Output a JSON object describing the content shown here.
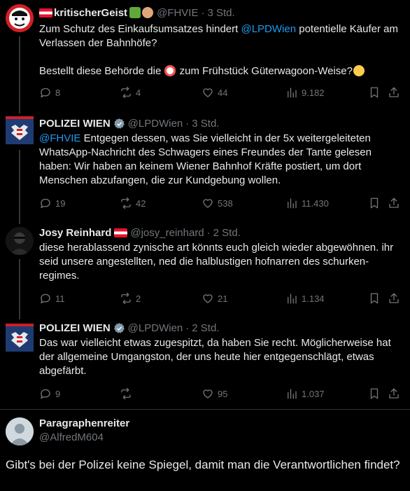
{
  "colors": {
    "background": "#000000",
    "text": "#e7e9ea",
    "muted": "#71767b",
    "link": "#1d9bf0",
    "verified": "#829aab"
  },
  "tweets": [
    {
      "name": "kritischerGeist",
      "handle": "@FHVIE",
      "time": "3 Std.",
      "text_before": "Zum Schutz des Einkaufsumsatzes hindert ",
      "mention": "@LPDWien",
      "text_after": " potentielle Käufer am Verlassen der Bahnhöfe?",
      "text2_before": "Bestellt diese Behörde die ",
      "text2_after": " zum Frühstück Güterwagoon-Weise?",
      "replies": "8",
      "reposts": "4",
      "likes": "44",
      "views": "9.182"
    },
    {
      "name": "POLIZEI WIEN",
      "handle": "@LPDWien",
      "time": "3 Std.",
      "mention": "@FHVIE",
      "text": " Entgegen dessen, was Sie vielleicht in der 5x weitergeleiteten WhatsApp-Nachricht des Schwagers eines Freundes der Tante gelesen haben: Wir haben an keinem Wiener Bahnhof Kräfte postiert, um dort Menschen abzufangen, die zur Kundgebung wollen.",
      "replies": "19",
      "reposts": "42",
      "likes": "538",
      "views": "11.430"
    },
    {
      "name": "Josy Reinhard",
      "handle": "@josy_reinhard",
      "time": "2 Std.",
      "text": "diese herablassend zynische art könnts euch gleich wieder abgewöhnen. ihr seid unsere angestellten, ned die halblustigen hofnarren des schurken-regimes.",
      "replies": "11",
      "reposts": "2",
      "likes": "21",
      "views": "1.134"
    },
    {
      "name": "POLIZEI WIEN",
      "handle": "@LPDWien",
      "time": "2 Std.",
      "text": "Das war vielleicht etwas zugespitzt, da haben Sie recht. Möglicherweise hat der allgemeine Umgangston, der uns heute hier entgegenschlägt, etwas abgefärbt.",
      "replies": "9",
      "reposts": "",
      "likes": "95",
      "views": "1.037"
    }
  ],
  "reply": {
    "name": "Paragraphenreiter",
    "handle": "@AlfredM604",
    "text": "Gibt's bei der Polizei keine Spiegel, damit man die Verantwortlichen findet?"
  },
  "icons": [
    "reply-icon",
    "repost-icon",
    "like-icon",
    "views-icon",
    "bookmark-icon",
    "share-icon",
    "verified-badge-icon",
    "austria-flag-icon"
  ]
}
